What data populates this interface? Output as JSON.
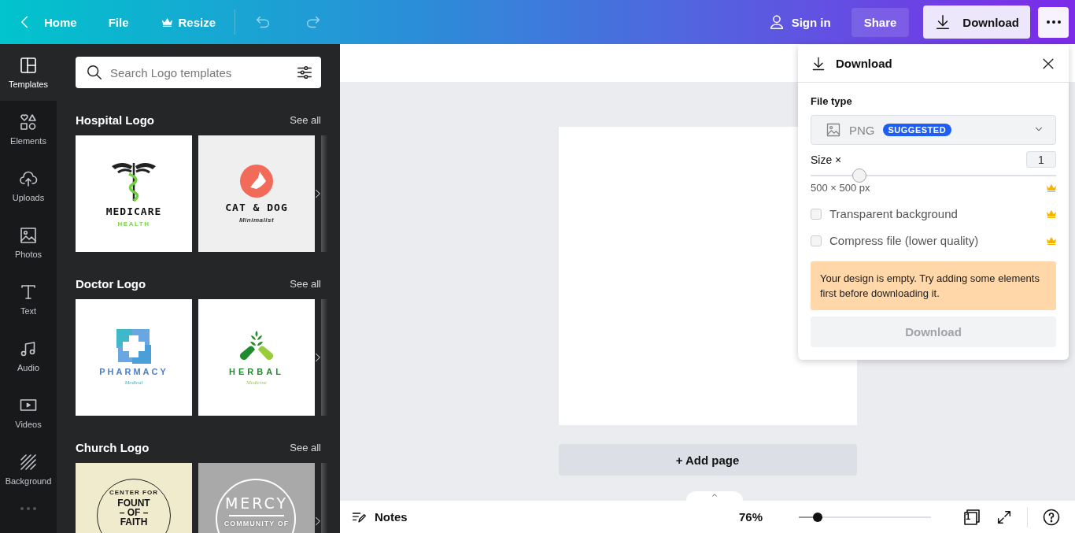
{
  "topbar": {
    "home": "Home",
    "file": "File",
    "resize": "Resize",
    "sign_in": "Sign in",
    "share": "Share",
    "download": "Download"
  },
  "rail": [
    {
      "kind": "templates",
      "label": "Templates",
      "selected": true
    },
    {
      "kind": "elements",
      "label": "Elements",
      "selected": false
    },
    {
      "kind": "uploads",
      "label": "Uploads",
      "selected": false
    },
    {
      "kind": "photos",
      "label": "Photos",
      "selected": false
    },
    {
      "kind": "text",
      "label": "Text",
      "selected": false
    },
    {
      "kind": "audio",
      "label": "Audio",
      "selected": false
    },
    {
      "kind": "videos",
      "label": "Videos",
      "selected": false
    },
    {
      "kind": "background",
      "label": "Background",
      "selected": false
    }
  ],
  "panel": {
    "search_placeholder": "Search Logo templates",
    "sections": [
      {
        "title": "Hospital Logo",
        "see_all": "See all",
        "templates": [
          {
            "kind": "medicare",
            "title": "MEDICARE",
            "subtitle": "HEALTH"
          },
          {
            "kind": "catdog",
            "title": "CAT & DOG",
            "subtitle": "Minimalist"
          }
        ]
      },
      {
        "title": "Doctor Logo",
        "see_all": "See all",
        "templates": [
          {
            "kind": "pharmacy",
            "title": "PHARMACY",
            "subtitle": "Medical"
          },
          {
            "kind": "herbal",
            "title": "HERBAL",
            "subtitle": "Medicine"
          }
        ]
      },
      {
        "title": "Church Logo",
        "see_all": "See all",
        "templates": [
          {
            "kind": "church",
            "top": "CENTER FOR",
            "title": "FOUNT",
            "middle": "– OF –",
            "subtitle": "FAITH"
          },
          {
            "kind": "mercy",
            "title": "MERCY",
            "subtitle": "COMMUNITY OF"
          }
        ]
      }
    ]
  },
  "canvas": {
    "add_page": "+ Add page"
  },
  "download_panel": {
    "title": "Download",
    "file_type_label": "File type",
    "format": "PNG",
    "badge": "SUGGESTED",
    "size_label": "Size ×",
    "size_value": "1",
    "size": {
      "level": 0.2
    },
    "dimensions": "500 × 500 px",
    "options": [
      {
        "label": "Transparent background",
        "checked": false
      },
      {
        "label": "Compress file (lower quality)",
        "checked": false
      }
    ],
    "warning": "Your design is empty. Try adding some elements first before downloading it.",
    "button": "Download",
    "button_disabled": true
  },
  "footer": {
    "notes": "Notes",
    "zoom": "76%",
    "zoom_slider": {
      "level": 0.14
    },
    "page_count": "1"
  }
}
